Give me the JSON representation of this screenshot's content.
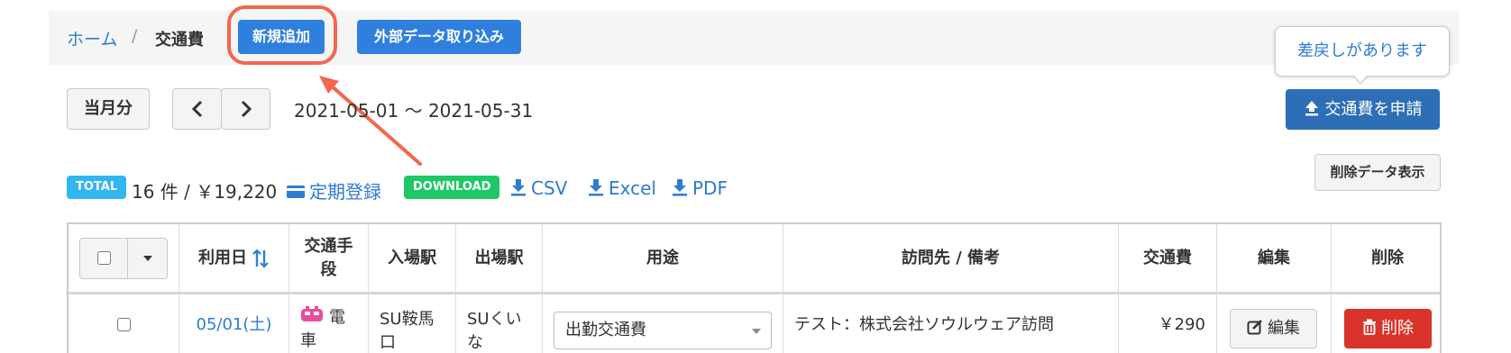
{
  "breadcrumb": {
    "home": "ホーム",
    "separator": "/",
    "current": "交通費"
  },
  "toolbar": {
    "add_new": "新規追加",
    "import_external": "外部データ取り込み"
  },
  "period": {
    "this_month": "当月分",
    "prev_icon": "chevron-left-icon",
    "next_icon": "chevron-right-icon",
    "range": "2021-05-01 〜 2021-05-31"
  },
  "notice": {
    "tooltip": "差戻しがあります",
    "apply_button": "交通費を申請",
    "apply_icon": "upload-icon"
  },
  "show_deleted": "削除データ表示",
  "summary": {
    "total_badge": "TOTAL",
    "total_text": "16 件 / ￥19,220",
    "commuter_pass": "定期登録"
  },
  "download": {
    "badge": "DOWNLOAD",
    "csv": "CSV",
    "excel": "Excel",
    "pdf": "PDF"
  },
  "table": {
    "headers": {
      "date": "利用日",
      "transport_l1": "交通手",
      "transport_l2": "段",
      "entry": "入場駅",
      "exit": "出場駅",
      "purpose": "用途",
      "destination": "訪問先 / 備考",
      "fare": "交通費",
      "edit": "編集",
      "delete": "削除"
    },
    "rows": [
      {
        "date": "05/01(土)",
        "transport_l1": "電",
        "transport_l2": "車",
        "entry_l1": "SU鞍馬",
        "entry_l2": "口",
        "exit_l1": "SUくい",
        "exit_l2": "な",
        "purpose": "出勤交通費",
        "destination": "テスト：株式会社ソウルウェア訪問",
        "fare": "￥290",
        "edit": "編集",
        "delete": "削除"
      }
    ]
  },
  "colors": {
    "primary": "#2f7fdf",
    "link": "#2f7bd0",
    "apply": "#2d6fb6",
    "total_badge": "#33b5f0",
    "download_badge": "#1ec866",
    "danger": "#d9342b",
    "highlight": "#f4664f"
  }
}
